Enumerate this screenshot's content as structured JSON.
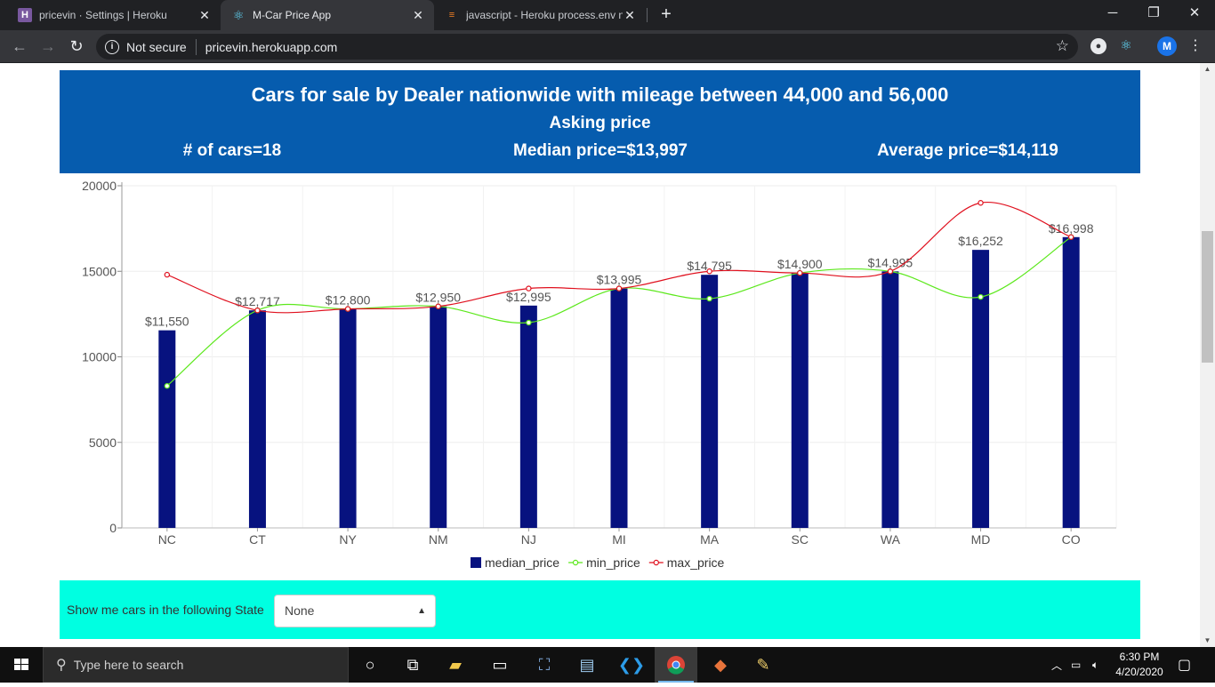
{
  "browser": {
    "tabs": [
      {
        "title": "pricevin · Settings | Heroku",
        "icon": "heroku-icon",
        "active": false
      },
      {
        "title": "M-Car Price App",
        "icon": "react-icon",
        "active": true
      },
      {
        "title": "javascript - Heroku process.env n",
        "icon": "stackoverflow-icon",
        "active": false
      }
    ],
    "security_label": "Not secure",
    "url": "pricevin.herokuapp.com",
    "profile_initial": "M"
  },
  "banner": {
    "title": "Cars for sale by Dealer nationwide with mileage between 44,000 and 56,000",
    "subtitle": "Asking price",
    "count_label": "# of cars=18",
    "median_label": "Median price=$13,997",
    "average_label": "Average price=$14,119",
    "background": "#065cae"
  },
  "chart_data": {
    "type": "bar",
    "categories": [
      "NC",
      "CT",
      "NY",
      "NM",
      "NJ",
      "MI",
      "MA",
      "SC",
      "WA",
      "MD",
      "CO"
    ],
    "y_ticks": [
      "0",
      "5000",
      "10000",
      "15000",
      "20000"
    ],
    "ylim": [
      0,
      20000
    ],
    "grid": true,
    "legend_position": "bottom-center",
    "series": [
      {
        "name": "median_price",
        "kind": "bar",
        "color": "#07127f",
        "values": [
          11550,
          12717,
          12800,
          12950,
          12995,
          13995,
          14795,
          14900,
          14995,
          16252,
          16998
        ],
        "labels": [
          "$11,550",
          "$12,717",
          "$12,800",
          "$12,950",
          "$12,995",
          "$13,995",
          "$14,795",
          "$14,900",
          "$14,995",
          "$16,252",
          "$16,998"
        ]
      },
      {
        "name": "min_price",
        "kind": "line",
        "color": "#5ce81c",
        "values": [
          8300,
          12717,
          12800,
          12950,
          12000,
          13995,
          13400,
          14900,
          14995,
          13500,
          16998
        ]
      },
      {
        "name": "max_price",
        "kind": "line",
        "color": "#e0101e",
        "values": [
          14800,
          12717,
          12800,
          12950,
          13995,
          13995,
          15000,
          14900,
          14995,
          19000,
          16998
        ]
      }
    ]
  },
  "filter": {
    "label": "Show me cars in the following State",
    "selected": "None",
    "background": "#00ffe1"
  },
  "taskbar": {
    "search_placeholder": "Type here to search",
    "time": "6:30 PM",
    "date": "4/20/2020"
  }
}
